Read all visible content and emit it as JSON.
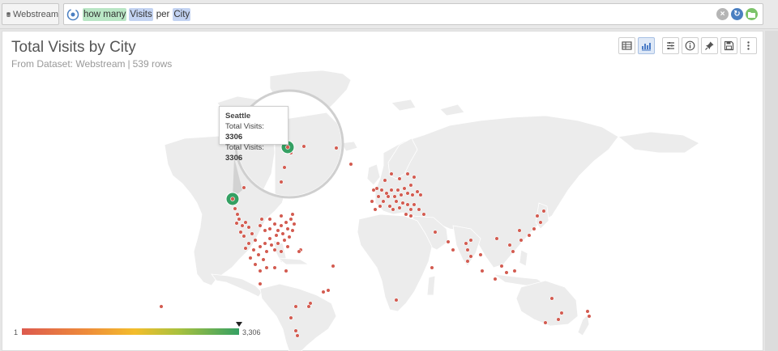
{
  "query_bar": {
    "source_label": "Webstream",
    "tokens": [
      {
        "text": "how many",
        "kind": "green"
      },
      {
        "text": "Visits",
        "kind": "blue"
      },
      {
        "text": "per",
        "kind": "plain"
      },
      {
        "text": "City",
        "kind": "blue"
      }
    ]
  },
  "card": {
    "title": "Total Visits by City",
    "subtitle_dataset": "From Dataset: Webstream",
    "subtitle_separator": "|",
    "subtitle_rows": "539 rows"
  },
  "tooltip": {
    "city": "Seattle",
    "line1_label": "Total Visits:",
    "line1_value": "3306",
    "line2_label": "Total Visits:",
    "line2_value": "3306"
  },
  "legend": {
    "min_label": "1",
    "max_label": "3,306",
    "marker_value": 3306,
    "min_value": 1,
    "max_value": 3306
  },
  "colors": {
    "point": "#d35b50",
    "highlight": "#35a063",
    "land": "#ececec",
    "land_stroke": "#ffffff",
    "active_tab": "#dfe9f7",
    "refresh": "#4a7fc1",
    "go": "#7cc36a"
  },
  "toolbar_icons": [
    "table-icon",
    "bar-chart-icon",
    "settings-list-icon",
    "info-icon",
    "pin-icon",
    "save-icon",
    "more-icon"
  ]
}
